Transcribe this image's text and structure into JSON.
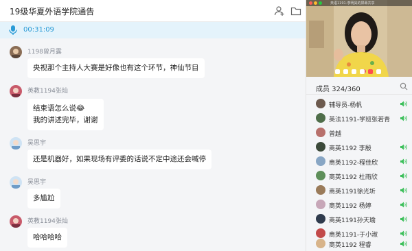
{
  "header": {
    "title": "19级华夏外语学院通告",
    "add_member_icon": "add-person-icon",
    "folder_icon": "folder-icon"
  },
  "recording": {
    "time": "00:31:09",
    "icon": "microphone-icon",
    "color": "#2a9bd6"
  },
  "messages": [
    {
      "user": "1198曾月露",
      "lines": [
        "央视那个主持人大赛是好像也有这个环节，神仙节目"
      ]
    },
    {
      "user": "英教1194张灿",
      "lines": [
        "结束语怎么说😂",
        "我的讲述完毕，谢谢"
      ]
    },
    {
      "user": "吴思宇",
      "lines": [
        "还是机器好，如果现场有评委的话说不定中途还会喊停"
      ]
    },
    {
      "user": "吴思宇",
      "lines": [
        "多尴尬"
      ]
    },
    {
      "user": "英教1194张灿",
      "lines": [
        "哈哈哈哈"
      ]
    }
  ],
  "video": {
    "caption": "英语1191-李明昊的屏幕共享"
  },
  "members": {
    "label": "成员 324/360",
    "list": [
      {
        "name": "辅导员-杨帆"
      },
      {
        "name": "英法1191-学班张若青"
      },
      {
        "name": "曾越"
      },
      {
        "name": "商英1192 李殷"
      },
      {
        "name": "商英1192-程佳欣"
      },
      {
        "name": "商英1192 杜雨欣"
      },
      {
        "name": "商英1191徐光圻"
      },
      {
        "name": "商英1192 杨婷"
      },
      {
        "name": "商英1191孙天瑜"
      },
      {
        "name": "商英1191-于小淑"
      },
      {
        "name": "商英1192 程睿"
      }
    ]
  },
  "colors": {
    "accent": "#2a9bd6",
    "speaker_green": "#3cbf5a",
    "chat_bg": "#f4f5f7",
    "bubble_bg": "#ffffff"
  }
}
